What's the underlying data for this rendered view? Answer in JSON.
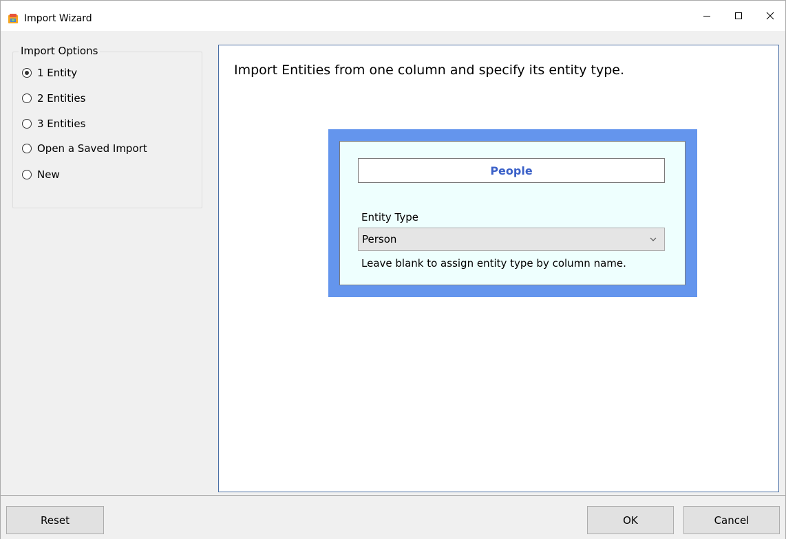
{
  "window": {
    "title": "Import Wizard",
    "icon": "app-icon",
    "controls": {
      "minimize": "minimize-icon",
      "maximize": "maximize-icon",
      "close": "close-icon"
    }
  },
  "import_options": {
    "legend": "Import Options",
    "options": [
      {
        "label": "1 Entity",
        "checked": true
      },
      {
        "label": "2 Entities",
        "checked": false
      },
      {
        "label": "3 Entities",
        "checked": false
      },
      {
        "label": "Open a Saved Import",
        "checked": false
      },
      {
        "label": "New",
        "checked": false
      }
    ]
  },
  "main": {
    "description": "Import Entities from one column and specify its entity type.",
    "entity": {
      "name": "People",
      "type_label": "Entity Type",
      "type_value": "Person",
      "hint": "Leave blank to assign entity type by column name."
    }
  },
  "footer": {
    "reset_label": "Reset",
    "ok_label": "OK",
    "cancel_label": "Cancel"
  },
  "colors": {
    "entity_frame": "#6495ed",
    "entity_card": "#eefffe",
    "entity_name_text": "#3b61c8",
    "panel_border": "#4a6fa5"
  }
}
